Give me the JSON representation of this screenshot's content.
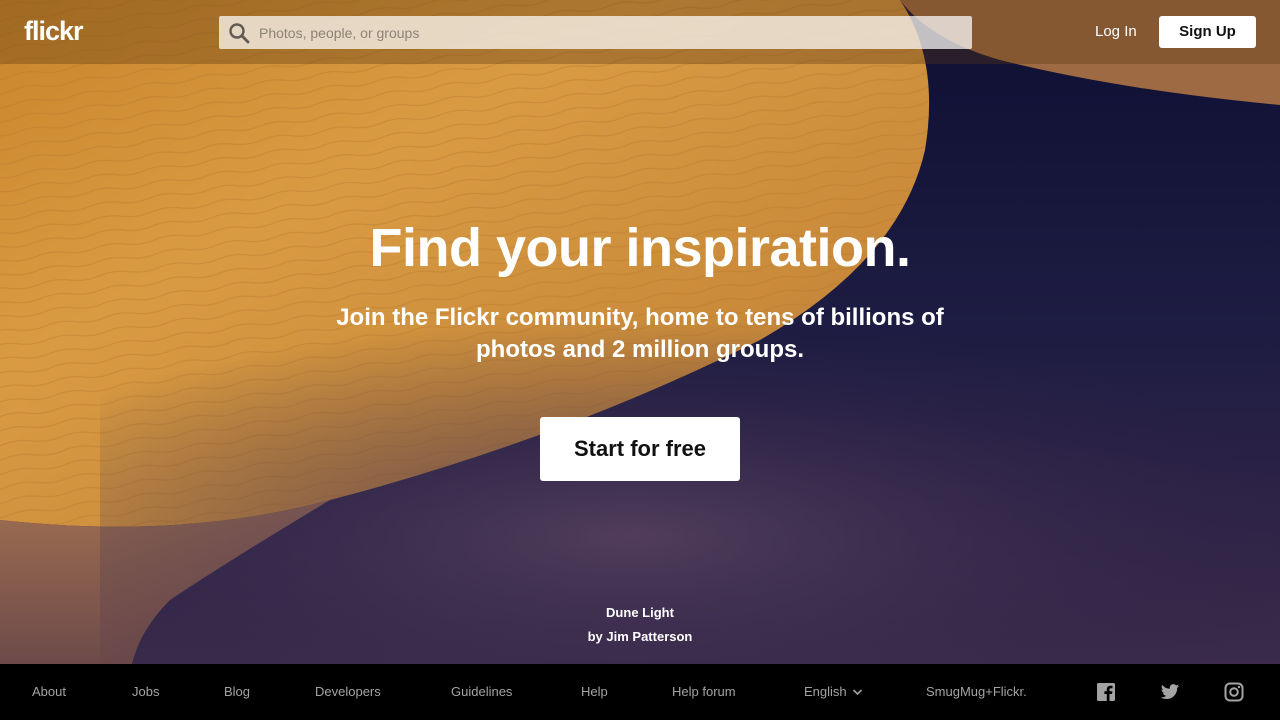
{
  "header": {
    "logo_text": "flickr",
    "search": {
      "placeholder": "Photos, people, or groups",
      "value": "",
      "icon": "search-icon"
    },
    "login_label": "Log In",
    "signup_label": "Sign Up"
  },
  "hero": {
    "title": "Find your inspiration.",
    "subtitle": "Join the Flickr community, home to tens of billions of photos and 2 million groups.",
    "cta_label": "Start for free",
    "photo_title": "Dune Light",
    "photo_author": "by Jim Patterson"
  },
  "footer": {
    "links": [
      "About",
      "Jobs",
      "Blog",
      "Developers",
      "Guidelines",
      "Help",
      "Help forum"
    ],
    "language": {
      "selected": "English",
      "icon": "chevron-down-icon"
    },
    "smugmug_label": "SmugMug+Flickr.",
    "social_icons": [
      "facebook-icon",
      "twitter-icon",
      "instagram-icon"
    ]
  },
  "colors": {
    "sand_light": "#d89a3c",
    "sand_dark": "#b06a1e",
    "shadow_navy": "#141637",
    "shadow_purple": "#4a3650",
    "footer_bg": "#000000",
    "footer_text": "#a3a3a3",
    "button_bg": "#ffffff"
  }
}
